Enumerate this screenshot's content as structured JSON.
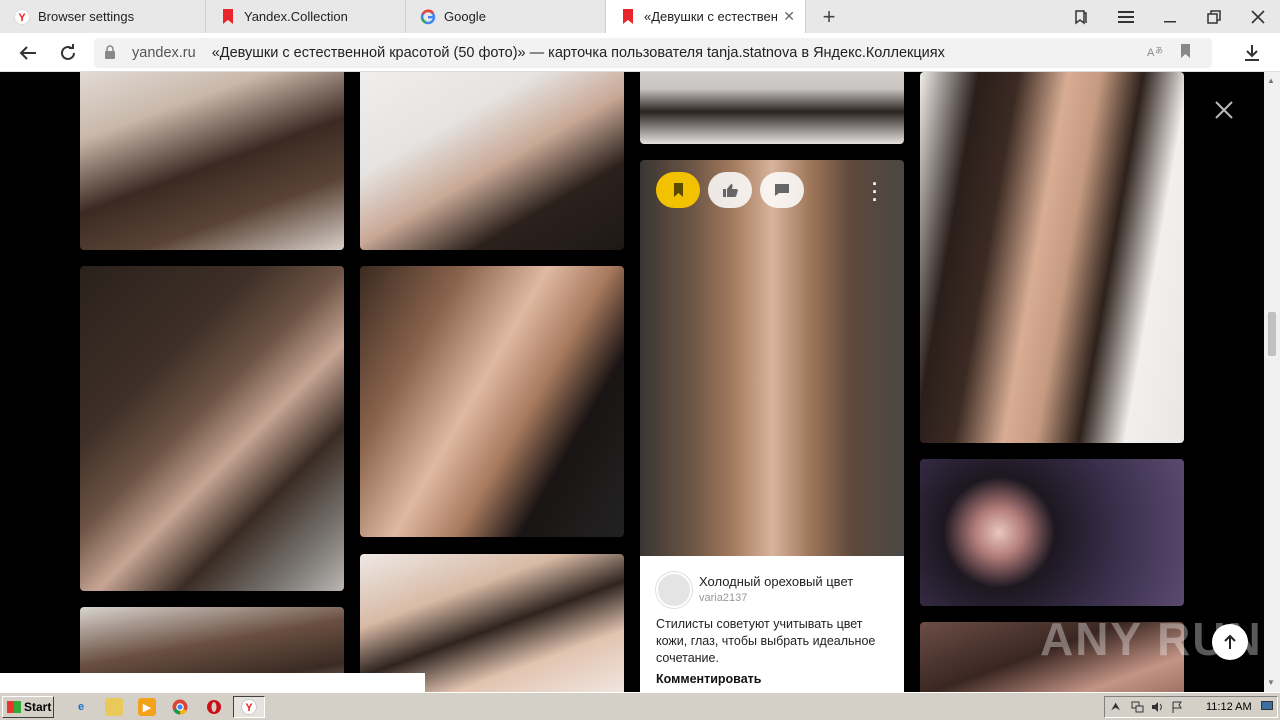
{
  "tabs": [
    {
      "title": "Browser settings",
      "icon": "yandex-icon"
    },
    {
      "title": "Yandex.Collection",
      "icon": "collection-bookmark-icon"
    },
    {
      "title": "Google",
      "icon": "google-icon"
    },
    {
      "title": "«Девушки с естественной",
      "icon": "collection-bookmark-icon",
      "active": true
    }
  ],
  "address": {
    "domain": "yandex.ru",
    "title": "«Девушки с естественной красотой (50 фото)» — карточка пользователя tanja.statnova в Яндекс.Коллекциях"
  },
  "pin": {
    "title": "Холодный ореховый цвет",
    "author": "varia2137",
    "description": "Стилисты советуют учитывать цвет кожи, глаз, чтобы выбрать идеальное сочетание.",
    "comment_label": "Комментировать"
  },
  "watermark": "ANY RUN",
  "taskbar": {
    "start_label": "Start",
    "clock": "11:12 AM"
  },
  "colors": {
    "save_button": "#f2c200",
    "background": "#000000"
  }
}
